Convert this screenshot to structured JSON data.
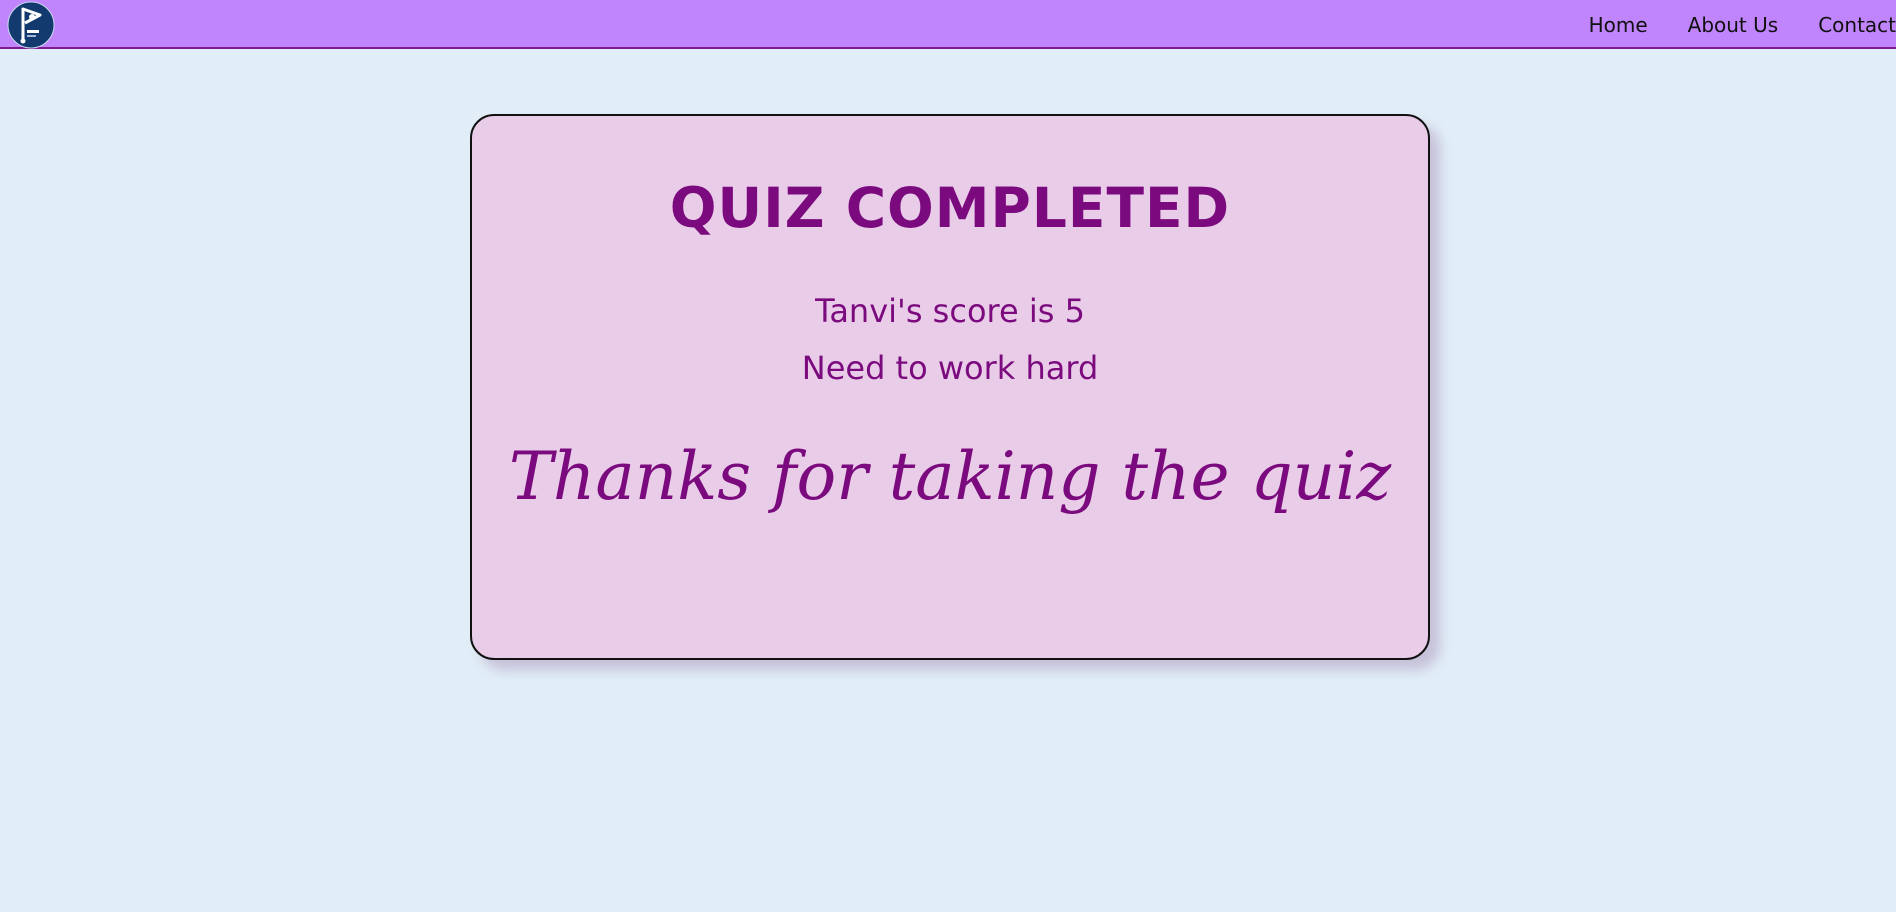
{
  "nav": {
    "logo_icon": "club-logo-icon",
    "links": [
      "Home",
      "About Us",
      "Contact"
    ]
  },
  "result": {
    "title": "QUIZ COMPLETED",
    "score_text": "Tanvi's score is 5",
    "remark": "Need to work hard",
    "thanks": "Thanks for taking the quiz"
  },
  "colors": {
    "navbar": "#c084fc",
    "page_background": "#e1eef7",
    "card_background": "#e9cde8",
    "text_accent": "#7b0a7e"
  }
}
